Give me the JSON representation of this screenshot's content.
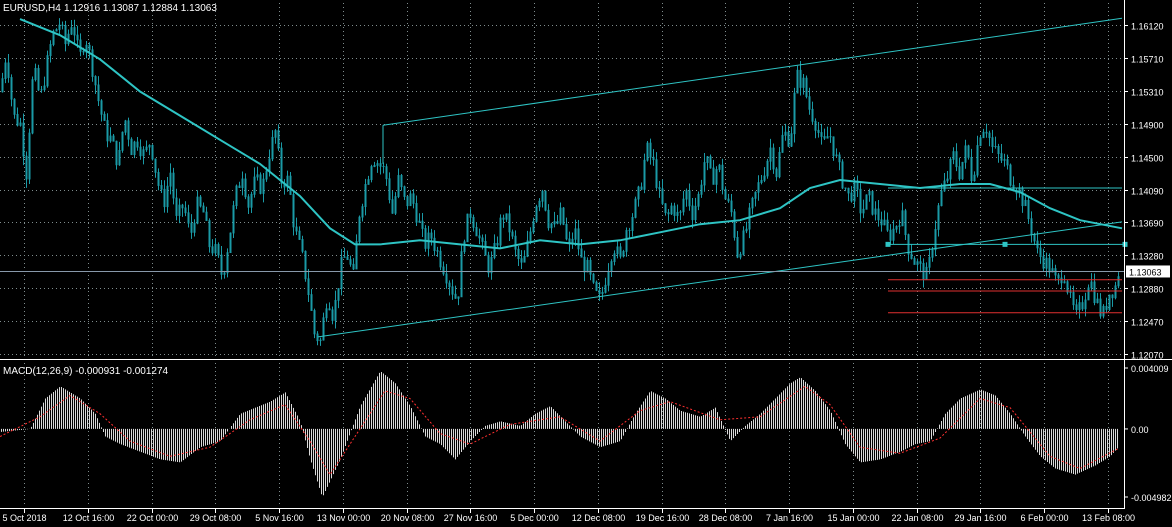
{
  "window": {
    "title": "EURUSD,H4",
    "ohlc": "1.12916 1.13087 1.12884 1.13063"
  },
  "indicator": {
    "label": "MACD(12,26,9) -0.000931 -0.001274"
  },
  "colors": {
    "background": "#000000",
    "grid": "#7f8c8d",
    "text": "#ffffff",
    "candle": "#1a9aa6",
    "ma": "#2ec4c4",
    "channel": "#2ec4c4",
    "resistance": "#e03030",
    "macd_hist": "#d9d9d9",
    "macd_signal": "#ff3030",
    "current_price_line": "#8899aa"
  },
  "chart_data": [
    {
      "type": "candlestick",
      "symbol": "EURUSD",
      "timeframe": "H4",
      "ylim": [
        1.12,
        1.164
      ],
      "y_ticks": [
        "1.16120",
        "1.15710",
        "1.15310",
        "1.14900",
        "1.14500",
        "1.14090",
        "1.13690",
        "1.13280",
        "1.12880",
        "1.12470",
        "1.12070"
      ],
      "current_price": "1.13063",
      "x_ticks": [
        "5 Oct 2018",
        "12 Oct 16:00",
        "22 Oct 00:00",
        "29 Oct 08:00",
        "5 Nov 16:00",
        "13 Nov 00:00",
        "20 Nov 08:00",
        "27 Nov 16:00",
        "5 Dec 00:00",
        "12 Dec 08:00",
        "19 Dec 16:00",
        "28 Dec 08:00",
        "7 Jan 16:00",
        "15 Jan 00:00",
        "22 Jan 08:00",
        "29 Jan 16:00",
        "6 Feb 00:00",
        "13 Feb 08:00"
      ],
      "price_path": [
        [
          0,
          1.153
        ],
        [
          6,
          1.158
        ],
        [
          13,
          1.15
        ],
        [
          20,
          1.149
        ],
        [
          26,
          1.143
        ],
        [
          33,
          1.156
        ],
        [
          40,
          1.152
        ],
        [
          46,
          1.156
        ],
        [
          52,
          1.16
        ],
        [
          59,
          1.1615
        ],
        [
          65,
          1.159
        ],
        [
          72,
          1.162
        ],
        [
          79,
          1.157
        ],
        [
          85,
          1.16
        ],
        [
          92,
          1.156
        ],
        [
          98,
          1.152
        ],
        [
          105,
          1.148
        ],
        [
          111,
          1.147
        ],
        [
          118,
          1.144
        ],
        [
          124,
          1.15
        ],
        [
          131,
          1.146
        ],
        [
          137,
          1.147
        ],
        [
          144,
          1.145
        ],
        [
          150,
          1.147
        ],
        [
          157,
          1.142
        ],
        [
          163,
          1.139
        ],
        [
          170,
          1.143
        ],
        [
          176,
          1.137
        ],
        [
          183,
          1.139
        ],
        [
          190,
          1.135
        ],
        [
          196,
          1.139
        ],
        [
          203,
          1.138
        ],
        [
          209,
          1.134
        ],
        [
          216,
          1.133
        ],
        [
          222,
          1.13
        ],
        [
          229,
          1.135
        ],
        [
          235,
          1.14
        ],
        [
          242,
          1.143
        ],
        [
          248,
          1.139
        ],
        [
          255,
          1.142
        ],
        [
          262,
          1.141
        ],
        [
          268,
          1.145
        ],
        [
          275,
          1.148
        ],
        [
          281,
          1.142
        ],
        [
          288,
          1.142
        ],
        [
          294,
          1.136
        ],
        [
          301,
          1.133
        ],
        [
          307,
          1.129
        ],
        [
          314,
          1.123
        ],
        [
          320,
          1.122
        ],
        [
          327,
          1.128
        ],
        [
          333,
          1.125
        ],
        [
          340,
          1.131
        ],
        [
          346,
          1.133
        ],
        [
          353,
          1.13
        ],
        [
          359,
          1.138
        ],
        [
          366,
          1.142
        ],
        [
          372,
          1.145
        ],
        [
          379,
          1.144
        ],
        [
          385,
          1.143
        ],
        [
          392,
          1.138
        ],
        [
          398,
          1.142
        ],
        [
          405,
          1.139
        ],
        [
          411,
          1.14
        ],
        [
          418,
          1.137
        ],
        [
          424,
          1.134
        ],
        [
          431,
          1.135
        ],
        [
          437,
          1.133
        ],
        [
          444,
          1.131
        ],
        [
          450,
          1.129
        ],
        [
          457,
          1.127
        ],
        [
          463,
          1.135
        ],
        [
          470,
          1.138
        ],
        [
          476,
          1.136
        ],
        [
          483,
          1.133
        ],
        [
          489,
          1.131
        ],
        [
          496,
          1.134
        ],
        [
          502,
          1.138
        ],
        [
          509,
          1.136
        ],
        [
          515,
          1.133
        ],
        [
          522,
          1.131
        ],
        [
          529,
          1.135
        ],
        [
          535,
          1.139
        ],
        [
          542,
          1.141
        ],
        [
          548,
          1.137
        ],
        [
          555,
          1.136
        ],
        [
          561,
          1.138
        ],
        [
          568,
          1.133
        ],
        [
          574,
          1.136
        ],
        [
          581,
          1.132
        ],
        [
          587,
          1.131
        ],
        [
          594,
          1.128
        ],
        [
          600,
          1.127
        ],
        [
          607,
          1.131
        ],
        [
          613,
          1.134
        ],
        [
          620,
          1.132
        ],
        [
          626,
          1.136
        ],
        [
          633,
          1.138
        ],
        [
          640,
          1.141
        ],
        [
          646,
          1.146
        ],
        [
          653,
          1.144
        ],
        [
          659,
          1.14
        ],
        [
          666,
          1.137
        ],
        [
          672,
          1.139
        ],
        [
          679,
          1.137
        ],
        [
          685,
          1.141
        ],
        [
          692,
          1.138
        ],
        [
          698,
          1.14
        ],
        [
          705,
          1.145
        ],
        [
          711,
          1.142
        ],
        [
          718,
          1.144
        ],
        [
          724,
          1.14
        ],
        [
          731,
          1.138
        ],
        [
          737,
          1.133
        ],
        [
          744,
          1.135
        ],
        [
          750,
          1.138
        ],
        [
          757,
          1.141
        ],
        [
          763,
          1.143
        ],
        [
          770,
          1.146
        ],
        [
          776,
          1.143
        ],
        [
          783,
          1.148
        ],
        [
          790,
          1.147
        ],
        [
          796,
          1.155
        ],
        [
          803,
          1.154
        ],
        [
          809,
          1.151
        ],
        [
          816,
          1.149
        ],
        [
          822,
          1.146
        ],
        [
          829,
          1.148
        ],
        [
          835,
          1.145
        ],
        [
          842,
          1.142
        ],
        [
          848,
          1.14
        ],
        [
          855,
          1.141
        ],
        [
          861,
          1.138
        ],
        [
          868,
          1.14
        ],
        [
          874,
          1.138
        ],
        [
          881,
          1.137
        ],
        [
          888,
          1.135
        ],
        [
          894,
          1.136
        ],
        [
          901,
          1.138
        ],
        [
          907,
          1.134
        ],
        [
          914,
          1.132
        ],
        [
          920,
          1.131
        ],
        [
          927,
          1.13
        ],
        [
          933,
          1.135
        ],
        [
          940,
          1.14
        ],
        [
          946,
          1.142
        ],
        [
          953,
          1.145
        ],
        [
          959,
          1.143
        ],
        [
          966,
          1.146
        ],
        [
          972,
          1.142
        ],
        [
          979,
          1.148
        ],
        [
          985,
          1.149
        ],
        [
          992,
          1.146
        ],
        [
          998,
          1.145
        ],
        [
          1005,
          1.144
        ],
        [
          1011,
          1.142
        ],
        [
          1018,
          1.141
        ],
        [
          1024,
          1.139
        ],
        [
          1031,
          1.136
        ],
        [
          1037,
          1.133
        ],
        [
          1044,
          1.132
        ],
        [
          1050,
          1.131
        ],
        [
          1057,
          1.129
        ],
        [
          1063,
          1.131
        ],
        [
          1070,
          1.127
        ],
        [
          1076,
          1.125
        ],
        [
          1083,
          1.127
        ],
        [
          1089,
          1.13
        ],
        [
          1096,
          1.127
        ],
        [
          1102,
          1.125
        ],
        [
          1109,
          1.128
        ],
        [
          1116,
          1.129
        ],
        [
          1118,
          1.1306
        ]
      ],
      "moving_average": [
        [
          20,
          1.162
        ],
        [
          60,
          1.16
        ],
        [
          100,
          1.157
        ],
        [
          140,
          1.153
        ],
        [
          180,
          1.15
        ],
        [
          220,
          1.147
        ],
        [
          260,
          1.144
        ],
        [
          300,
          1.14
        ],
        [
          330,
          1.136
        ],
        [
          355,
          1.134
        ],
        [
          380,
          1.134
        ],
        [
          420,
          1.1345
        ],
        [
          460,
          1.134
        ],
        [
          500,
          1.1335
        ],
        [
          540,
          1.1345
        ],
        [
          580,
          1.134
        ],
        [
          620,
          1.1345
        ],
        [
          660,
          1.1355
        ],
        [
          700,
          1.1365
        ],
        [
          740,
          1.137
        ],
        [
          780,
          1.1385
        ],
        [
          810,
          1.141
        ],
        [
          840,
          1.142
        ],
        [
          880,
          1.1415
        ],
        [
          920,
          1.141
        ],
        [
          960,
          1.1415
        ],
        [
          990,
          1.1415
        ],
        [
          1020,
          1.1405
        ],
        [
          1050,
          1.1385
        ],
        [
          1080,
          1.137
        ],
        [
          1122,
          1.136
        ]
      ],
      "channel_upper": [
        [
          383,
          1.1488
        ],
        [
          1122,
          1.1621
        ]
      ],
      "channel_lower": [
        [
          318,
          1.1225
        ],
        [
          1122,
          1.1368
        ]
      ],
      "channel_left_edge": [
        [
          383,
          1.1488
        ],
        [
          383,
          1.144
        ]
      ],
      "support_line": [
        [
          888,
          1.134
        ],
        [
          1125,
          1.134
        ]
      ],
      "resistance_top": [
        [
          888,
          1.141
        ],
        [
          1122,
          1.141
        ]
      ],
      "resistance_lines": [
        1.1296,
        1.1282,
        1.1255
      ]
    },
    {
      "type": "macd",
      "ylim": [
        -0.005,
        0.0044
      ],
      "y_ticks": [
        "0.004009",
        "0.00",
        "-0.004982"
      ],
      "histogram_path": [
        [
          0,
          -0.0002
        ],
        [
          30,
          0.0
        ],
        [
          45,
          0.002
        ],
        [
          60,
          0.0028
        ],
        [
          80,
          0.002
        ],
        [
          95,
          0.001
        ],
        [
          105,
          -0.0005
        ],
        [
          120,
          -0.001
        ],
        [
          140,
          -0.0015
        ],
        [
          160,
          -0.002
        ],
        [
          180,
          -0.0022
        ],
        [
          200,
          -0.0012
        ],
        [
          220,
          -0.0008
        ],
        [
          240,
          0.001
        ],
        [
          255,
          0.0014
        ],
        [
          270,
          0.0018
        ],
        [
          285,
          0.0024
        ],
        [
          300,
          0.0005
        ],
        [
          310,
          -0.002
        ],
        [
          322,
          -0.0045
        ],
        [
          340,
          -0.002
        ],
        [
          360,
          0.0015
        ],
        [
          380,
          0.0038
        ],
        [
          395,
          0.003
        ],
        [
          410,
          0.0015
        ],
        [
          425,
          -0.0005
        ],
        [
          440,
          -0.001
        ],
        [
          455,
          -0.002
        ],
        [
          470,
          -0.0008
        ],
        [
          485,
          0.0002
        ],
        [
          500,
          0.0005
        ],
        [
          520,
          0.0002
        ],
        [
          535,
          0.001
        ],
        [
          550,
          0.0015
        ],
        [
          565,
          0.0005
        ],
        [
          580,
          -0.0005
        ],
        [
          600,
          -0.0012
        ],
        [
          620,
          -0.0008
        ],
        [
          635,
          0.001
        ],
        [
          650,
          0.0025
        ],
        [
          665,
          0.002
        ],
        [
          680,
          0.0012
        ],
        [
          700,
          0.0008
        ],
        [
          715,
          0.0014
        ],
        [
          730,
          -0.0008
        ],
        [
          745,
          0.0002
        ],
        [
          760,
          0.001
        ],
        [
          775,
          0.002
        ],
        [
          790,
          0.003
        ],
        [
          800,
          0.0034
        ],
        [
          815,
          0.0025
        ],
        [
          830,
          0.0012
        ],
        [
          845,
          -0.001
        ],
        [
          860,
          -0.0022
        ],
        [
          880,
          -0.002
        ],
        [
          900,
          -0.0015
        ],
        [
          915,
          -0.001
        ],
        [
          930,
          -0.0008
        ],
        [
          945,
          0.001
        ],
        [
          960,
          0.002
        ],
        [
          980,
          0.0026
        ],
        [
          995,
          0.0022
        ],
        [
          1010,
          0.001
        ],
        [
          1025,
          -0.0005
        ],
        [
          1040,
          -0.0018
        ],
        [
          1055,
          -0.0026
        ],
        [
          1075,
          -0.003
        ],
        [
          1095,
          -0.0024
        ],
        [
          1110,
          -0.0018
        ],
        [
          1118,
          -0.0012
        ]
      ],
      "signal_path": [
        [
          0,
          -0.0005
        ],
        [
          40,
          0.0008
        ],
        [
          70,
          0.0022
        ],
        [
          100,
          0.001
        ],
        [
          130,
          -0.0008
        ],
        [
          170,
          -0.0018
        ],
        [
          210,
          -0.0012
        ],
        [
          250,
          0.0006
        ],
        [
          285,
          0.0016
        ],
        [
          310,
          -0.0008
        ],
        [
          330,
          -0.003
        ],
        [
          355,
          -0.0005
        ],
        [
          385,
          0.0025
        ],
        [
          410,
          0.002
        ],
        [
          440,
          -0.0003
        ],
        [
          470,
          -0.001
        ],
        [
          510,
          0.0003
        ],
        [
          560,
          0.0008
        ],
        [
          600,
          -0.0008
        ],
        [
          640,
          0.0012
        ],
        [
          670,
          0.0018
        ],
        [
          720,
          0.0006
        ],
        [
          760,
          0.0008
        ],
        [
          805,
          0.0028
        ],
        [
          830,
          0.0016
        ],
        [
          860,
          -0.0012
        ],
        [
          900,
          -0.0016
        ],
        [
          940,
          -0.0006
        ],
        [
          980,
          0.002
        ],
        [
          1010,
          0.0014
        ],
        [
          1050,
          -0.0018
        ],
        [
          1080,
          -0.0026
        ],
        [
          1118,
          -0.0013
        ]
      ]
    }
  ]
}
